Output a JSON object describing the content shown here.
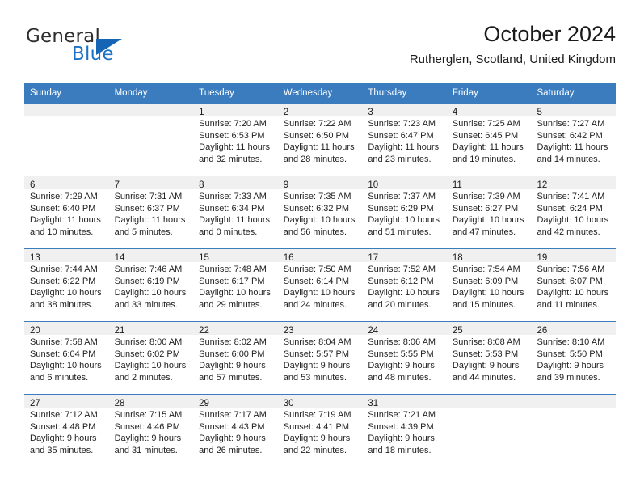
{
  "brand": {
    "name_part1": "General",
    "name_part2": "Blue",
    "colors": {
      "blue": "#1c72c4",
      "dark": "#2e2e2e",
      "triangle": "#1565b4"
    }
  },
  "header": {
    "title": "October 2024",
    "subtitle": "Rutherglen, Scotland, United Kingdom"
  },
  "theme": {
    "header_blue": "#3a7cbe",
    "day_band_gray": "#f0f0f0",
    "text": "#1f1f1f"
  },
  "weekdays": [
    "Sunday",
    "Monday",
    "Tuesday",
    "Wednesday",
    "Thursday",
    "Friday",
    "Saturday"
  ],
  "weeks": [
    [
      {
        "day": "",
        "empty": true,
        "sunrise": "",
        "sunset": "",
        "daylight_1": "",
        "daylight_2": ""
      },
      {
        "day": "",
        "empty": true,
        "sunrise": "",
        "sunset": "",
        "daylight_1": "",
        "daylight_2": ""
      },
      {
        "day": "1",
        "sunrise": "Sunrise: 7:20 AM",
        "sunset": "Sunset: 6:53 PM",
        "daylight_1": "Daylight: 11 hours",
        "daylight_2": "and 32 minutes."
      },
      {
        "day": "2",
        "sunrise": "Sunrise: 7:22 AM",
        "sunset": "Sunset: 6:50 PM",
        "daylight_1": "Daylight: 11 hours",
        "daylight_2": "and 28 minutes."
      },
      {
        "day": "3",
        "sunrise": "Sunrise: 7:23 AM",
        "sunset": "Sunset: 6:47 PM",
        "daylight_1": "Daylight: 11 hours",
        "daylight_2": "and 23 minutes."
      },
      {
        "day": "4",
        "sunrise": "Sunrise: 7:25 AM",
        "sunset": "Sunset: 6:45 PM",
        "daylight_1": "Daylight: 11 hours",
        "daylight_2": "and 19 minutes."
      },
      {
        "day": "5",
        "sunrise": "Sunrise: 7:27 AM",
        "sunset": "Sunset: 6:42 PM",
        "daylight_1": "Daylight: 11 hours",
        "daylight_2": "and 14 minutes."
      }
    ],
    [
      {
        "day": "6",
        "sunrise": "Sunrise: 7:29 AM",
        "sunset": "Sunset: 6:40 PM",
        "daylight_1": "Daylight: 11 hours",
        "daylight_2": "and 10 minutes."
      },
      {
        "day": "7",
        "sunrise": "Sunrise: 7:31 AM",
        "sunset": "Sunset: 6:37 PM",
        "daylight_1": "Daylight: 11 hours",
        "daylight_2": "and 5 minutes."
      },
      {
        "day": "8",
        "sunrise": "Sunrise: 7:33 AM",
        "sunset": "Sunset: 6:34 PM",
        "daylight_1": "Daylight: 11 hours",
        "daylight_2": "and 0 minutes."
      },
      {
        "day": "9",
        "sunrise": "Sunrise: 7:35 AM",
        "sunset": "Sunset: 6:32 PM",
        "daylight_1": "Daylight: 10 hours",
        "daylight_2": "and 56 minutes."
      },
      {
        "day": "10",
        "sunrise": "Sunrise: 7:37 AM",
        "sunset": "Sunset: 6:29 PM",
        "daylight_1": "Daylight: 10 hours",
        "daylight_2": "and 51 minutes."
      },
      {
        "day": "11",
        "sunrise": "Sunrise: 7:39 AM",
        "sunset": "Sunset: 6:27 PM",
        "daylight_1": "Daylight: 10 hours",
        "daylight_2": "and 47 minutes."
      },
      {
        "day": "12",
        "sunrise": "Sunrise: 7:41 AM",
        "sunset": "Sunset: 6:24 PM",
        "daylight_1": "Daylight: 10 hours",
        "daylight_2": "and 42 minutes."
      }
    ],
    [
      {
        "day": "13",
        "sunrise": "Sunrise: 7:44 AM",
        "sunset": "Sunset: 6:22 PM",
        "daylight_1": "Daylight: 10 hours",
        "daylight_2": "and 38 minutes."
      },
      {
        "day": "14",
        "sunrise": "Sunrise: 7:46 AM",
        "sunset": "Sunset: 6:19 PM",
        "daylight_1": "Daylight: 10 hours",
        "daylight_2": "and 33 minutes."
      },
      {
        "day": "15",
        "sunrise": "Sunrise: 7:48 AM",
        "sunset": "Sunset: 6:17 PM",
        "daylight_1": "Daylight: 10 hours",
        "daylight_2": "and 29 minutes."
      },
      {
        "day": "16",
        "sunrise": "Sunrise: 7:50 AM",
        "sunset": "Sunset: 6:14 PM",
        "daylight_1": "Daylight: 10 hours",
        "daylight_2": "and 24 minutes."
      },
      {
        "day": "17",
        "sunrise": "Sunrise: 7:52 AM",
        "sunset": "Sunset: 6:12 PM",
        "daylight_1": "Daylight: 10 hours",
        "daylight_2": "and 20 minutes."
      },
      {
        "day": "18",
        "sunrise": "Sunrise: 7:54 AM",
        "sunset": "Sunset: 6:09 PM",
        "daylight_1": "Daylight: 10 hours",
        "daylight_2": "and 15 minutes."
      },
      {
        "day": "19",
        "sunrise": "Sunrise: 7:56 AM",
        "sunset": "Sunset: 6:07 PM",
        "daylight_1": "Daylight: 10 hours",
        "daylight_2": "and 11 minutes."
      }
    ],
    [
      {
        "day": "20",
        "sunrise": "Sunrise: 7:58 AM",
        "sunset": "Sunset: 6:04 PM",
        "daylight_1": "Daylight: 10 hours",
        "daylight_2": "and 6 minutes."
      },
      {
        "day": "21",
        "sunrise": "Sunrise: 8:00 AM",
        "sunset": "Sunset: 6:02 PM",
        "daylight_1": "Daylight: 10 hours",
        "daylight_2": "and 2 minutes."
      },
      {
        "day": "22",
        "sunrise": "Sunrise: 8:02 AM",
        "sunset": "Sunset: 6:00 PM",
        "daylight_1": "Daylight: 9 hours",
        "daylight_2": "and 57 minutes."
      },
      {
        "day": "23",
        "sunrise": "Sunrise: 8:04 AM",
        "sunset": "Sunset: 5:57 PM",
        "daylight_1": "Daylight: 9 hours",
        "daylight_2": "and 53 minutes."
      },
      {
        "day": "24",
        "sunrise": "Sunrise: 8:06 AM",
        "sunset": "Sunset: 5:55 PM",
        "daylight_1": "Daylight: 9 hours",
        "daylight_2": "and 48 minutes."
      },
      {
        "day": "25",
        "sunrise": "Sunrise: 8:08 AM",
        "sunset": "Sunset: 5:53 PM",
        "daylight_1": "Daylight: 9 hours",
        "daylight_2": "and 44 minutes."
      },
      {
        "day": "26",
        "sunrise": "Sunrise: 8:10 AM",
        "sunset": "Sunset: 5:50 PM",
        "daylight_1": "Daylight: 9 hours",
        "daylight_2": "and 39 minutes."
      }
    ],
    [
      {
        "day": "27",
        "sunrise": "Sunrise: 7:12 AM",
        "sunset": "Sunset: 4:48 PM",
        "daylight_1": "Daylight: 9 hours",
        "daylight_2": "and 35 minutes."
      },
      {
        "day": "28",
        "sunrise": "Sunrise: 7:15 AM",
        "sunset": "Sunset: 4:46 PM",
        "daylight_1": "Daylight: 9 hours",
        "daylight_2": "and 31 minutes."
      },
      {
        "day": "29",
        "sunrise": "Sunrise: 7:17 AM",
        "sunset": "Sunset: 4:43 PM",
        "daylight_1": "Daylight: 9 hours",
        "daylight_2": "and 26 minutes."
      },
      {
        "day": "30",
        "sunrise": "Sunrise: 7:19 AM",
        "sunset": "Sunset: 4:41 PM",
        "daylight_1": "Daylight: 9 hours",
        "daylight_2": "and 22 minutes."
      },
      {
        "day": "31",
        "sunrise": "Sunrise: 7:21 AM",
        "sunset": "Sunset: 4:39 PM",
        "daylight_1": "Daylight: 9 hours",
        "daylight_2": "and 18 minutes."
      },
      {
        "day": "",
        "empty": true,
        "sunrise": "",
        "sunset": "",
        "daylight_1": "",
        "daylight_2": ""
      },
      {
        "day": "",
        "empty": true,
        "sunrise": "",
        "sunset": "",
        "daylight_1": "",
        "daylight_2": ""
      }
    ]
  ]
}
